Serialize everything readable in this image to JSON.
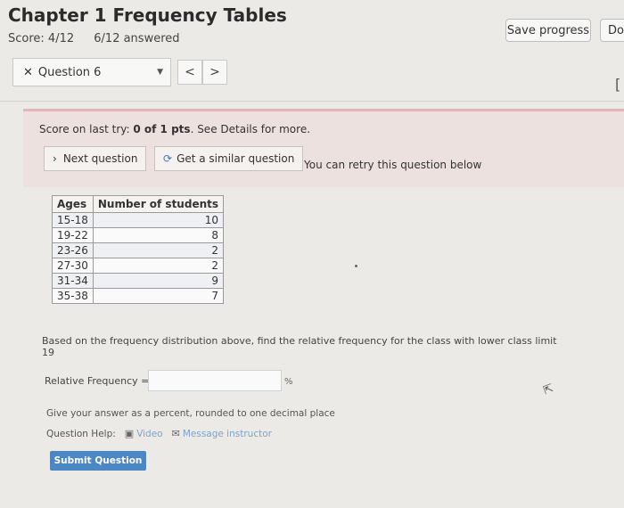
{
  "header": {
    "title": "Chapter 1 Frequency Tables",
    "score": "Score: 4/12",
    "answered": "6/12 answered",
    "save_label": "Save progress",
    "done_label": "Done"
  },
  "question_nav": {
    "selected": "Question 6",
    "prev_glyph": "<",
    "next_glyph": ">",
    "edge_glyph": "["
  },
  "feedback": {
    "prefix": "Score on last try: ",
    "score": "0 of 1",
    "mid": " pts",
    "suffix": ". See Details for more.",
    "next_label": "Next question",
    "similar_label": "Get a similar question",
    "retry_text": "You can retry this question below"
  },
  "table": {
    "headers": [
      "Ages",
      "Number of students"
    ],
    "rows": [
      [
        "15-18",
        "10"
      ],
      [
        "19-22",
        "8"
      ],
      [
        "23-26",
        "2"
      ],
      [
        "27-30",
        "2"
      ],
      [
        "31-34",
        "9"
      ],
      [
        "35-38",
        "7"
      ]
    ]
  },
  "question": {
    "prompt": "Based on the frequency distribution above, find the relative frequency for the class with lower class limit 19",
    "field_label": "Relative Frequency =",
    "field_value": "",
    "unit": "%",
    "hint": "Give your answer as a percent, rounded to one decimal place",
    "help_label": "Question Help:",
    "video_label": "Video",
    "message_label": "Message instructor",
    "submit_label": "Submit Question"
  }
}
